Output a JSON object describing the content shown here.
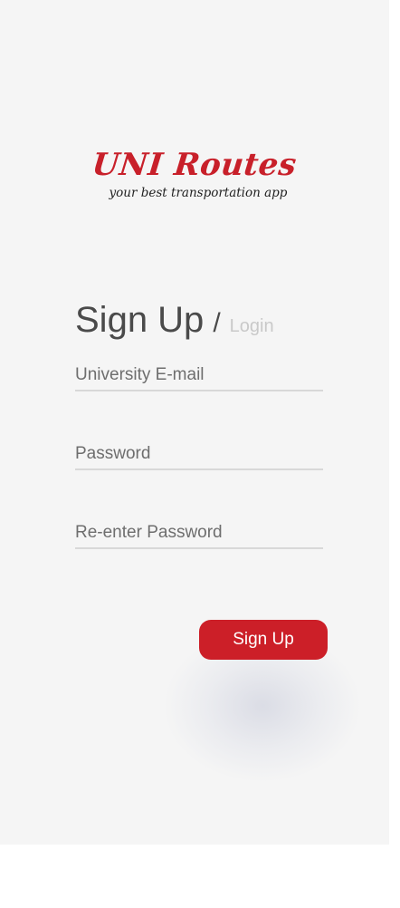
{
  "brand": {
    "title": "UNI Routes",
    "tagline": "your best transportation app",
    "accent_color": "#cc1f28"
  },
  "heading": {
    "active": "Sign Up",
    "separator": "/",
    "inactive": "Login"
  },
  "form": {
    "email_placeholder": "University E-mail",
    "email_value": "",
    "password_placeholder": "Password",
    "password_value": "",
    "confirm_placeholder": "Re-enter Password",
    "confirm_value": "",
    "submit_label": "Sign Up"
  }
}
